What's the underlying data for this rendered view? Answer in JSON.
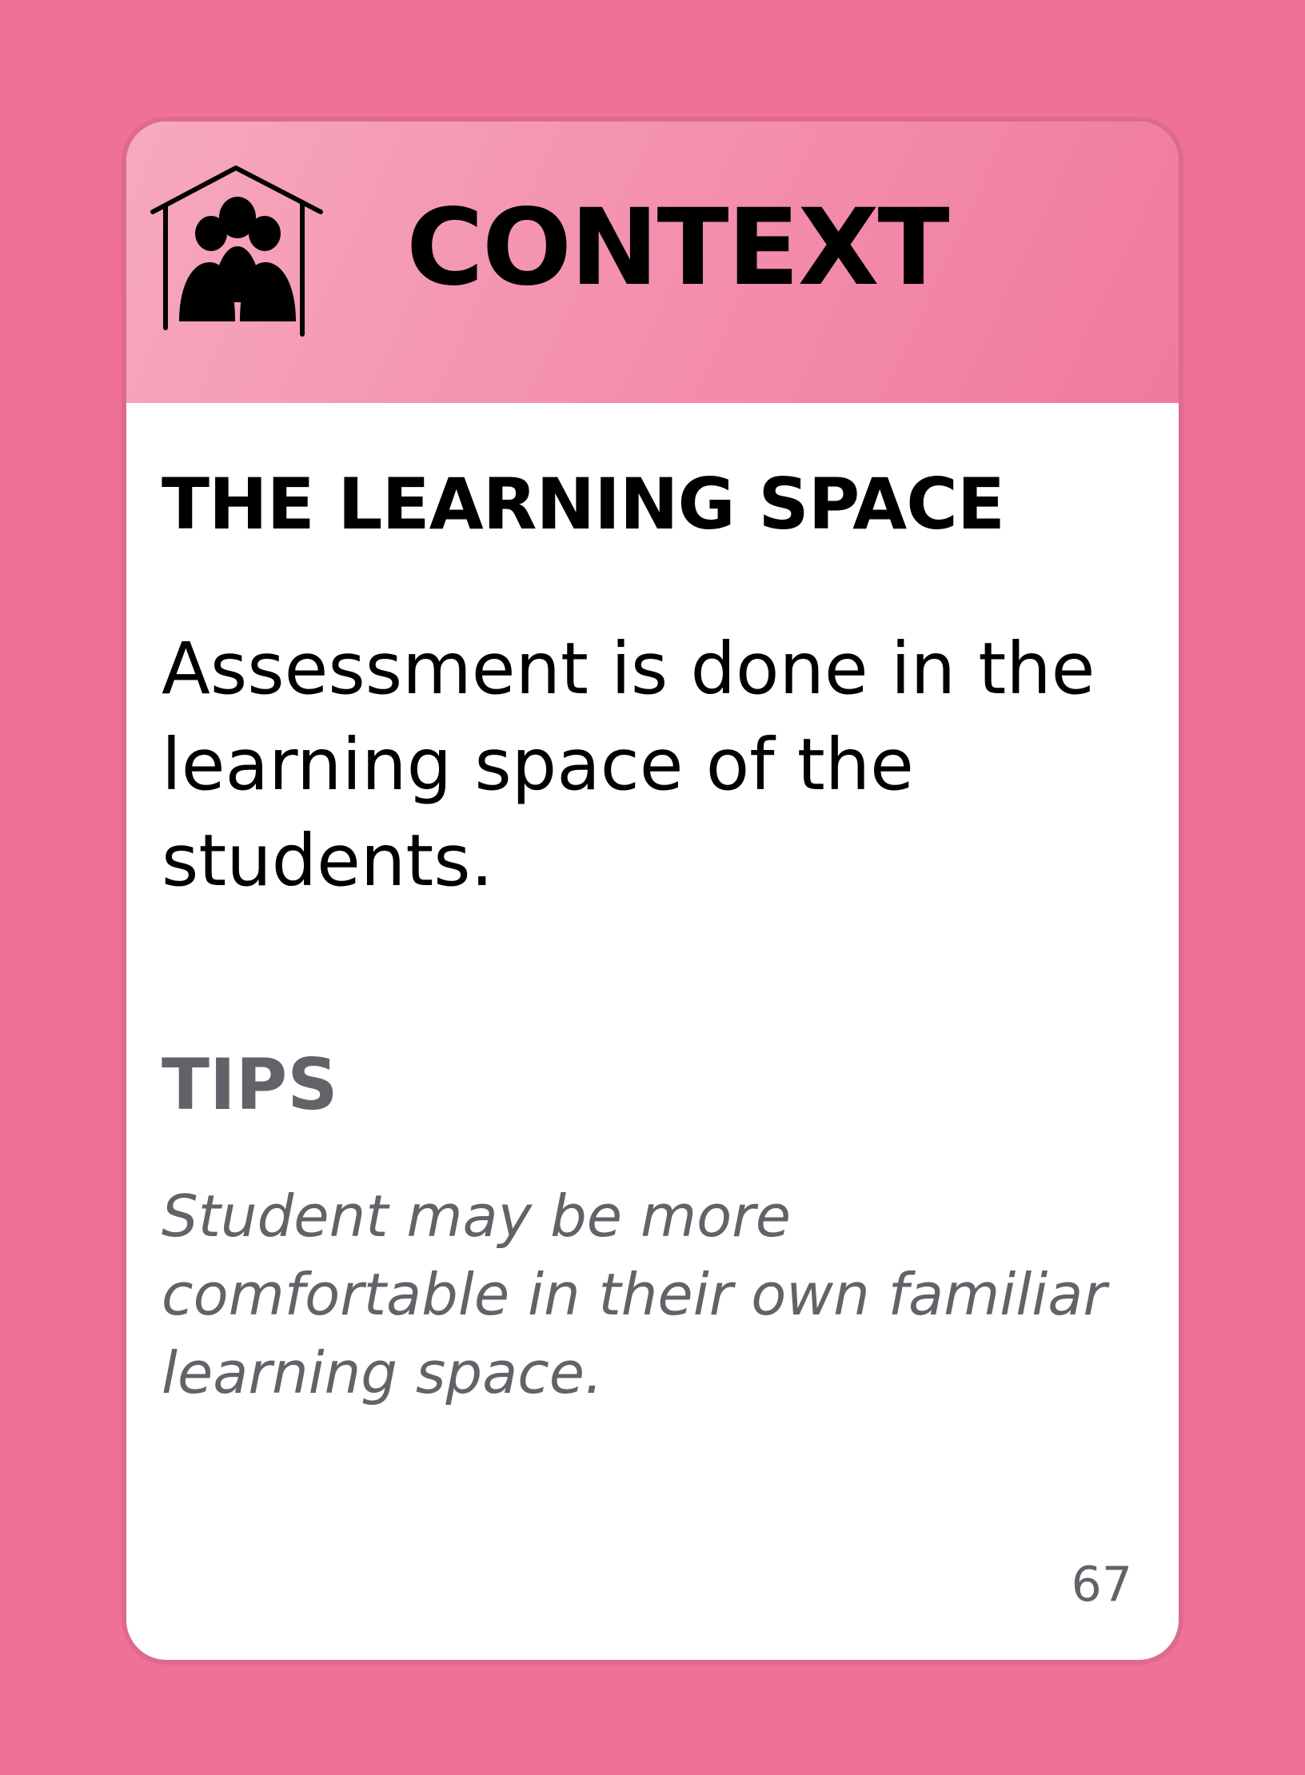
{
  "header": {
    "category": "CONTEXT",
    "icon": "house-people-icon"
  },
  "card": {
    "title": "THE LEARNING SPACE",
    "description": "Assessment is done in the learning space of the students.",
    "tips_heading": "TIPS",
    "tips_text": "Student may be more comfortable in their own familiar learning space.",
    "page_number": "67"
  },
  "colors": {
    "background": "#ef7196",
    "header_light": "#f6a9bd",
    "header_dark": "#f07a9e",
    "card_border": "#de6a8e",
    "body_text": "#000000",
    "tips_text": "#626368"
  }
}
